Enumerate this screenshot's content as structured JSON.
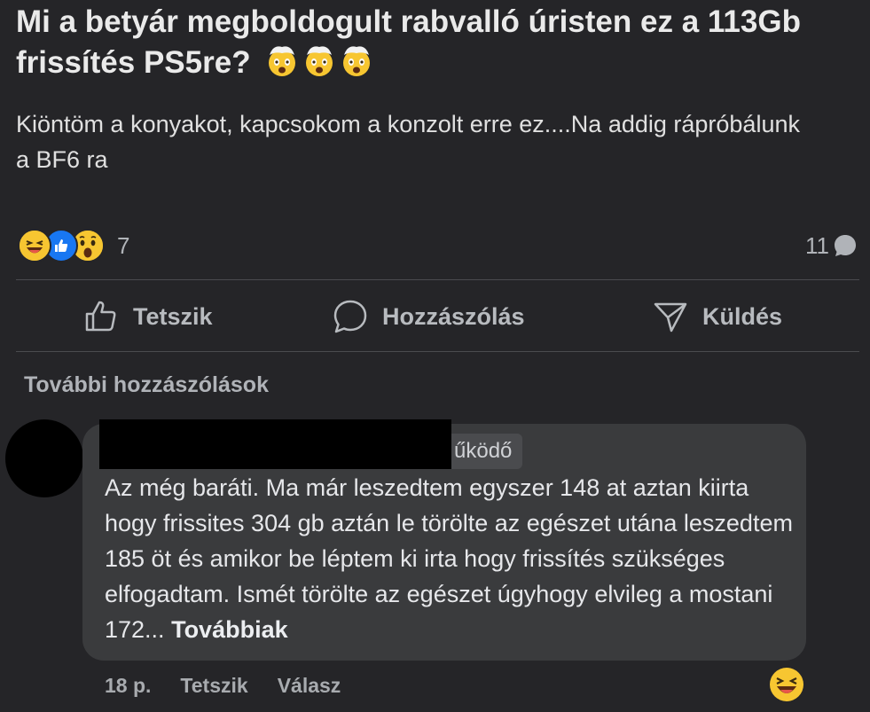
{
  "post": {
    "title": "Mi a betyár megboldogult rabvalló úristen ez a 113Gb frissítés PS5re?",
    "title_emojis": [
      "exploding-head-icon",
      "exploding-head-icon",
      "exploding-head-icon"
    ],
    "body": "Kiöntöm a konyakot, kapcsokom a konzolt erre ez....Na addig rápróbálunk a BF6 ra",
    "reaction_icons": [
      "grinning-squint-icon",
      "like-icon",
      "wow-icon"
    ],
    "reaction_count": "7",
    "comment_count": "11"
  },
  "actions": {
    "like_label": "Tetszik",
    "comment_label": "Hozzászólás",
    "send_label": "Küldés"
  },
  "comments_section": {
    "more_label": "További hozzászólások"
  },
  "comment": {
    "author_visible_fragment": "űködő",
    "text": "Az még baráti. Ma már leszedtem egyszer 148 at aztan kiirta hogy frissites 304 gb aztán le törölte az egészet utána leszedtem 185 öt és amikor be léptem ki irta hogy frissítés szükséges elfogadtam. Ismét törölte az egészet úgyhogy elvileg a mostani 172...",
    "see_more_label": "Továbbiak",
    "time": "18 p.",
    "like_label": "Tetszik",
    "reply_label": "Válasz",
    "reaction_icon": "grinning-squint-icon"
  },
  "colors": {
    "background": "#252528",
    "bubble": "#3a3b3d",
    "like_blue": "#1877f2",
    "emoji_yellow": "#f7c631"
  }
}
